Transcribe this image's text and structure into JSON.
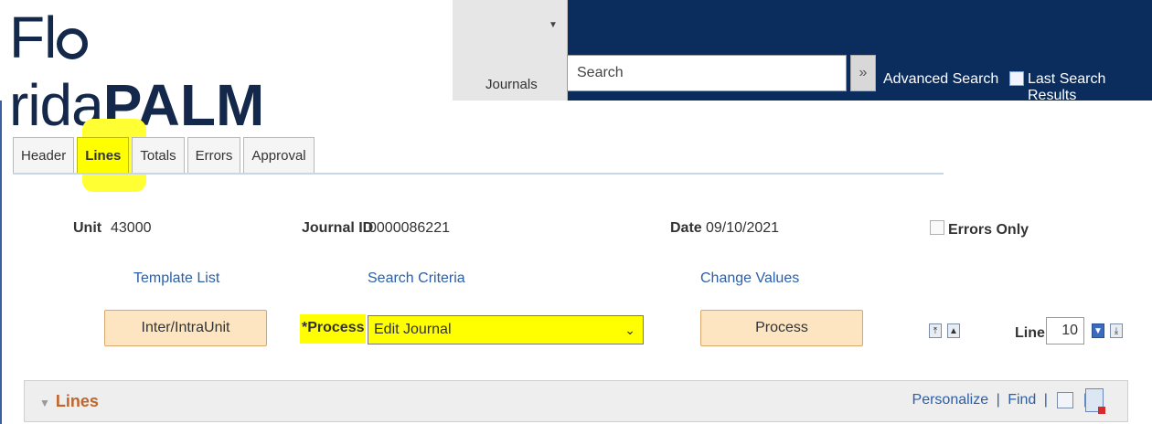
{
  "header": {
    "logo_part1": "Fl",
    "logo_part2": "rida",
    "logo_part3": "PALM",
    "module_label": "Journals",
    "search_placeholder": "Search",
    "search_go_symbol": "»",
    "advanced_search": "Advanced Search",
    "last_search_results": "Last Search Results"
  },
  "tabs": [
    {
      "label": "Header"
    },
    {
      "label": "Lines",
      "active": true
    },
    {
      "label": "Totals"
    },
    {
      "label": "Errors"
    },
    {
      "label": "Approval"
    }
  ],
  "info": {
    "unit_label": "Unit",
    "unit_value": "43000",
    "journal_id_label": "Journal ID",
    "journal_id_value": "0000086221",
    "date_label": "Date",
    "date_value": "09/10/2021",
    "errors_only_label": "Errors Only"
  },
  "links": {
    "template_list": "Template List",
    "search_criteria": "Search Criteria",
    "change_values": "Change Values"
  },
  "actions": {
    "inter_intra_unit": "Inter/IntraUnit",
    "process_label": "*Process",
    "process_selected": "Edit Journal",
    "process_button": "Process",
    "line_label": "Line",
    "line_value": "10"
  },
  "lines_section": {
    "title": "Lines",
    "personalize": "Personalize",
    "find": "Find",
    "separator": "|"
  },
  "colors": {
    "header_bar": "#0a2d5e",
    "highlight": "#ffff00",
    "link": "#2b5fa8",
    "button_bg": "#fde5c2",
    "section_title": "#c0652b"
  }
}
